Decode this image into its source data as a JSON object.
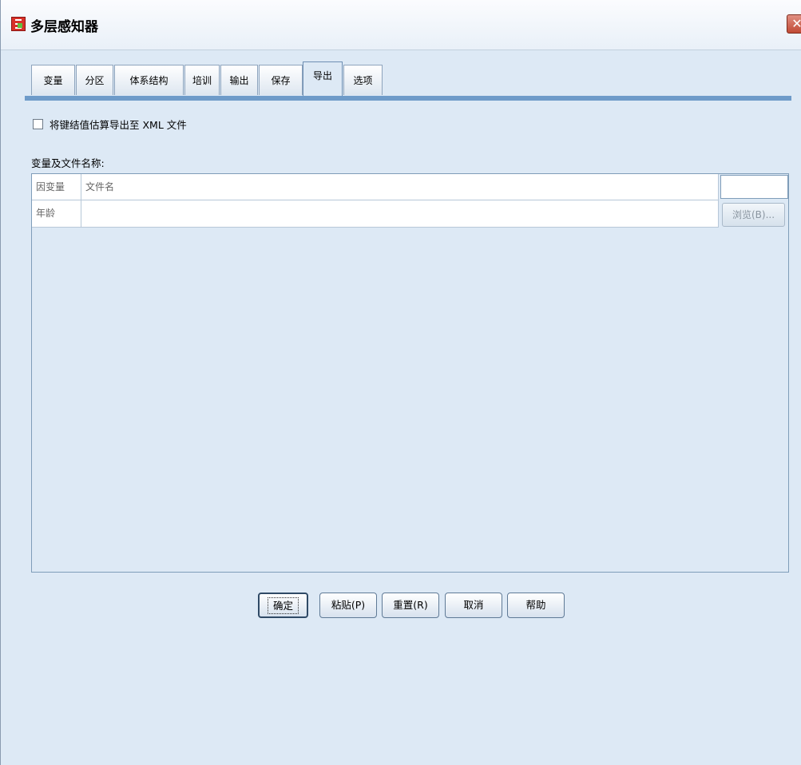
{
  "window": {
    "title": "多层感知器",
    "close_glyph": "✕"
  },
  "tabs": [
    {
      "label": "变量"
    },
    {
      "label": "分区"
    },
    {
      "label": "体系结构"
    },
    {
      "label": "培训"
    },
    {
      "label": "输出"
    },
    {
      "label": "保存"
    },
    {
      "label": "导出"
    },
    {
      "label": "选项"
    }
  ],
  "active_tab": "导出",
  "export_checkbox": {
    "label": "将键结值估算导出至 XML 文件",
    "checked": false
  },
  "section_label": "变量及文件名称:",
  "table": {
    "headers": [
      "因变量",
      "文件名"
    ],
    "rows": [
      {
        "variable": "年龄",
        "filename": "",
        "browse_label": "浏览(B)..."
      }
    ]
  },
  "buttons": {
    "ok": "确定",
    "paste": "粘贴(P)",
    "reset": "重置(R)",
    "cancel": "取消",
    "help": "帮助"
  },
  "colors": {
    "panel_bg": "#dde9f5",
    "tab_accent": "#6e9bc9"
  }
}
